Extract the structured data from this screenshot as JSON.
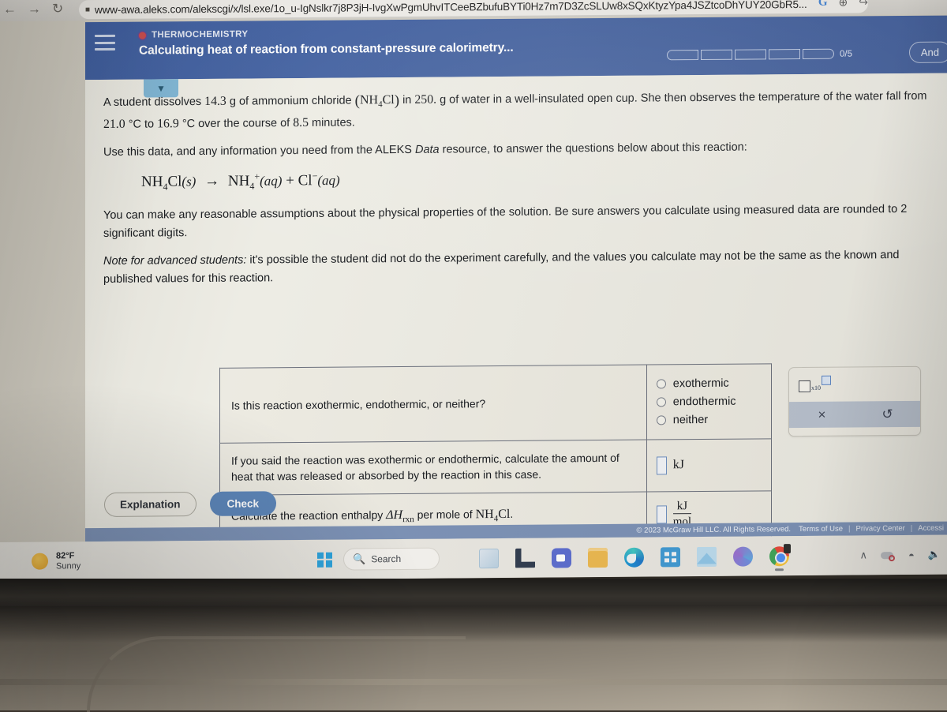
{
  "browser": {
    "back_icon": "back-arrow-icon",
    "forward_icon": "forward-arrow-icon",
    "reload_icon": "reload-icon",
    "lock_icon": "site-info-icon",
    "url": "www-awa.aleks.com/alekscgi/x/lsl.exe/1o_u-IgNslkr7j8P3jH-IvgXwPgmUhvITCeeBZbufuBYTi0Hz7m7D3ZcSLUw8xSQxKtyzYpa4JSZtcoDhYUY20GbR5...",
    "google_icon": "G",
    "zoom_icon": "⊕",
    "share_icon": "↪"
  },
  "header": {
    "menu_icon": "hamburger-menu-icon",
    "topic": "THERMOCHEMISTRY",
    "title": "Calculating heat of reaction from constant-pressure calorimetry...",
    "progress_count": "0/5",
    "progress_segments": 5,
    "and_button": "And",
    "accent_color": "#3e5b99"
  },
  "sheet": {
    "collapse_icon": "chevron-down-icon",
    "paragraph1": {
      "a": "A student dissolves",
      "mass": "14.3",
      "b": "g of ammonium chloride",
      "formula": "NH4Cl",
      "c": "in",
      "water_mass": "250.",
      "d": "g of water in a well-insulated open cup. She then observes the temperature of the water fall from",
      "t_initial": "21.0",
      "e": "°C to",
      "t_final": "16.9",
      "f": "°C over the course of",
      "time": "8.5",
      "g": "minutes."
    },
    "paragraph2_pre": "Use this data, and any information you need from the ALEKS",
    "paragraph2_italic": "Data",
    "paragraph2_post": "resource, to answer the questions below about this reaction:",
    "equation": {
      "reactant": "NH4Cl(s)",
      "arrow": "→",
      "product1": "NH4+(aq)",
      "plus": "+",
      "product2": "Cl−(aq)"
    },
    "paragraph3": "You can make any reasonable assumptions about the physical properties of the solution. Be sure answers you calculate using measured data are rounded to 2 significant digits.",
    "note_label": "Note for advanced students:",
    "note_text": "it's possible the student did not do the experiment carefully, and the values you calculate may not be the same as the known and published values for this reaction."
  },
  "table": {
    "rows": [
      {
        "question": "Is this reaction exothermic, endothermic, or neither?",
        "answer_type": "radio",
        "options": [
          "exothermic",
          "endothermic",
          "neither"
        ]
      },
      {
        "question": "If you said the reaction was exothermic or endothermic, calculate the amount of heat that was released or absorbed by the reaction in this case.",
        "answer_type": "input-unit",
        "unit": "kJ"
      },
      {
        "question_pre": "Calculate the reaction enthalpy",
        "question_symbol": "ΔH",
        "question_sub": "rxn",
        "question_mid": "per mole of",
        "question_formula": "NH4Cl",
        "question_post": ".",
        "answer_type": "input-fraction",
        "unit_numerator": "kJ",
        "unit_denominator": "mol"
      }
    ]
  },
  "keypad": {
    "sci_notation_label": "x10",
    "clear_icon": "×",
    "undo_icon": "↺"
  },
  "actions": {
    "explanation": "Explanation",
    "check": "Check",
    "check_color": "#5a84b8"
  },
  "footer": {
    "copyright": "© 2023 McGraw Hill LLC. All Rights Reserved.",
    "terms": "Terms of Use",
    "privacy": "Privacy Center",
    "accessibility": "Accessi",
    "separator": "|"
  },
  "taskbar": {
    "weather_temp": "82°F",
    "weather_desc": "Sunny",
    "weather_icon": "sun-icon",
    "start_icon": "windows-start-icon",
    "search_icon": "search-icon",
    "search_label": "Search",
    "apps": [
      "widgets-icon",
      "file-explorer-icon",
      "teams-icon",
      "folder-icon",
      "edge-icon",
      "microsoft-store-icon",
      "mail-icon",
      "onedrive-icon",
      "chrome-icon"
    ],
    "tray": {
      "chevron_icon": "∧",
      "cloud_icon": "cloud-sync-icon",
      "wifi_icon": "◠",
      "volume_icon": "◁"
    }
  }
}
